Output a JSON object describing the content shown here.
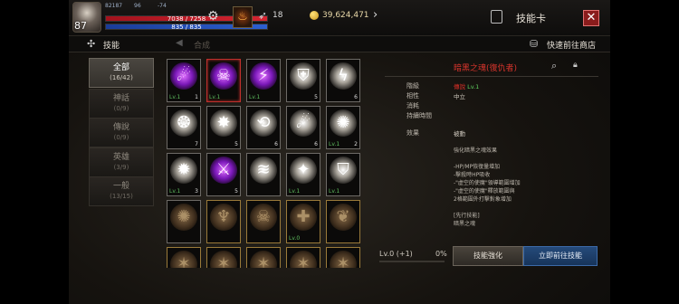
{
  "hud": {
    "level": "87",
    "stat_a": "82187",
    "stat_b": "96",
    "stat_c": "-74",
    "hp": "7038 / 7258",
    "mp": "835 / 835",
    "feather_count": "18",
    "gold": "39,624,471",
    "title": "技能卡",
    "close_label": "✕"
  },
  "tabs": {
    "skill": "技能",
    "compose": "合成",
    "shop_link": "快速前往商店"
  },
  "categories": [
    {
      "label": "全部",
      "count": "(16/42)"
    },
    {
      "label": "神話",
      "count": "(0/9)"
    },
    {
      "label": "傳說",
      "count": "(0/9)"
    },
    {
      "label": "英雄",
      "count": "(3/9)"
    },
    {
      "label": "一般",
      "count": "(13/15)"
    }
  ],
  "tiles": [
    {
      "icon": "purple-comet-icon",
      "glyph": "☄",
      "style": "purple",
      "border": "gray",
      "lv": "Lv.1",
      "count": "1"
    },
    {
      "icon": "purple-skull-icon",
      "glyph": "☠",
      "style": "purple",
      "border": "red",
      "lv": "Lv.1",
      "count": ""
    },
    {
      "icon": "purple-claw-icon",
      "glyph": "⚡",
      "style": "purple",
      "border": "gray",
      "lv": "Lv.1",
      "count": ""
    },
    {
      "icon": "shield-icon",
      "glyph": "⛨",
      "style": "white",
      "border": "gray",
      "lv": "",
      "count": "5"
    },
    {
      "icon": "lightning-icon",
      "glyph": "ϟ",
      "style": "white",
      "border": "gray",
      "lv": "",
      "count": "6"
    },
    {
      "icon": "flame-wave-icon",
      "glyph": "❂",
      "style": "white",
      "border": "gray",
      "lv": "",
      "count": "7"
    },
    {
      "icon": "starburst-icon",
      "glyph": "✸",
      "style": "white",
      "border": "gray",
      "lv": "",
      "count": "5"
    },
    {
      "icon": "wing-slash-icon",
      "glyph": "⟲",
      "style": "white",
      "border": "gray",
      "lv": "",
      "count": "6"
    },
    {
      "icon": "comet-icon",
      "glyph": "☄",
      "style": "white",
      "border": "gray",
      "lv": "",
      "count": "6"
    },
    {
      "icon": "sun-emblem-icon",
      "glyph": "✺",
      "style": "white",
      "border": "gray",
      "lv": "Lv.1",
      "count": "2"
    },
    {
      "icon": "explosion-icon",
      "glyph": "✹",
      "style": "white",
      "border": "gray",
      "lv": "Lv.1",
      "count": "3"
    },
    {
      "icon": "purple-slash-icon",
      "glyph": "⚔",
      "style": "purple",
      "border": "gray",
      "lv": "",
      "count": "5"
    },
    {
      "icon": "wind-slash-icon",
      "glyph": "≋",
      "style": "white",
      "border": "gray",
      "lv": "",
      "count": ""
    },
    {
      "icon": "star-wings-icon",
      "glyph": "✦",
      "style": "white",
      "border": "gray",
      "lv": "Lv.1",
      "count": ""
    },
    {
      "icon": "shield-flame-icon",
      "glyph": "⛉",
      "style": "white",
      "border": "gray",
      "lv": "Lv.1",
      "count": ""
    },
    {
      "icon": "bronze-blast-icon",
      "glyph": "✺",
      "style": "bronze",
      "border": "gray",
      "lv": "",
      "count": ""
    },
    {
      "icon": "bronze-figure-icon",
      "glyph": "♆",
      "style": "bronze",
      "border": "gold",
      "lv": "",
      "count": ""
    },
    {
      "icon": "bronze-skull-icon",
      "glyph": "☠",
      "style": "bronze",
      "border": "gold",
      "lv": "",
      "count": ""
    },
    {
      "icon": "bronze-cross-icon",
      "glyph": "✚",
      "style": "bronze",
      "border": "gold",
      "lv": "Lv.0",
      "count": ""
    },
    {
      "icon": "bronze-boot-icon",
      "glyph": "❦",
      "style": "bronze",
      "border": "gold",
      "lv": "",
      "count": ""
    },
    {
      "icon": "bronze-rune-icon",
      "glyph": "✶",
      "style": "bronze",
      "border": "gold",
      "lv": "",
      "count": ""
    },
    {
      "icon": "bronze-rune-icon",
      "glyph": "✶",
      "style": "bronze",
      "border": "gold",
      "lv": "",
      "count": ""
    },
    {
      "icon": "bronze-rune-icon",
      "glyph": "✶",
      "style": "bronze",
      "border": "gold",
      "lv": "",
      "count": ""
    },
    {
      "icon": "bronze-rune-icon",
      "glyph": "✶",
      "style": "bronze",
      "border": "gold",
      "lv": "",
      "count": ""
    },
    {
      "icon": "bronze-rune-icon",
      "glyph": "✶",
      "style": "bronze",
      "border": "gold",
      "lv": "",
      "count": ""
    }
  ],
  "detail": {
    "title": "暗黑之魂(復仇者)",
    "rows": [
      {
        "label": "階級",
        "value": "傳說",
        "value2": "Lv.1"
      },
      {
        "label": "相性",
        "value": "中立",
        "value2": ""
      },
      {
        "label": "消耗",
        "value": "",
        "value2": ""
      },
      {
        "label": "持續時間",
        "value": "",
        "value2": ""
      }
    ],
    "effect_label": "效果",
    "effect_value": "被動",
    "effect_desc": "強化暗黑之魂效果\n\n-HP/MP恢復量增加\n-擊殺時HP吸收\n-\"虛空的使魔\"領導範圍增加\n-\"虛空的使魔\"釋放範圍與\n2格範圍外打擊對象增加\n\n[先行技能]\n暗黑之魂"
  },
  "controls": {
    "level_label": "Lv.0 (+1)",
    "level_pct": "0%",
    "enhance_label": "技能強化",
    "goto_label": "立即前往技能"
  }
}
